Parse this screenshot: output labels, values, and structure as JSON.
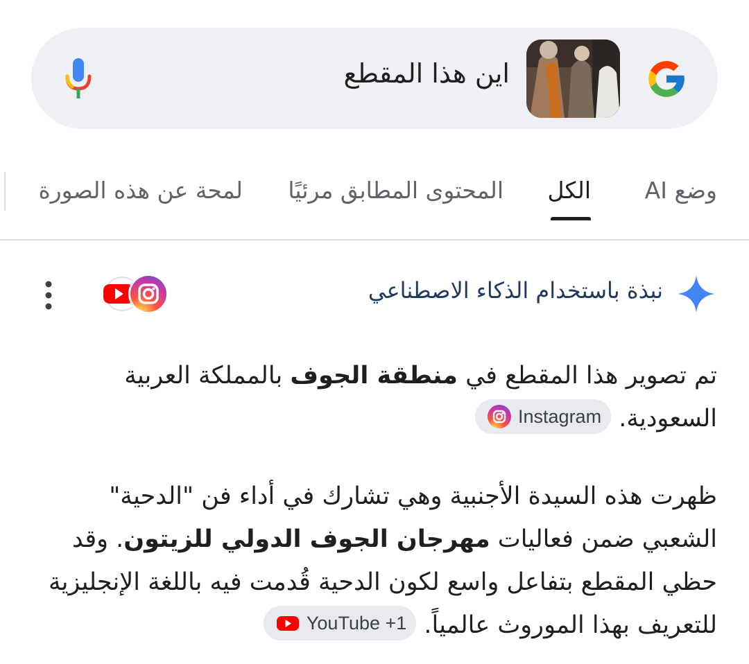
{
  "search": {
    "query": "اين هذا المقطع",
    "thumbnail": "image-thumbnail-people"
  },
  "tabs": [
    {
      "label": "وضع AI",
      "active": false
    },
    {
      "label": "الكل",
      "active": true
    },
    {
      "label": "المحتوى المطابق مرئيًا",
      "active": false
    },
    {
      "label": "لمحة عن هذه الصورة",
      "active": false
    }
  ],
  "ai_overview": {
    "title": "نبذة باستخدام الذكاء الاصطناعي",
    "icon": "sparkle-icon",
    "sources_icons": [
      "youtube-icon",
      "instagram-icon"
    ]
  },
  "paragraph1": {
    "t1": "تم تصوير هذا المقطع في ",
    "b1": "منطقة الجوف",
    "t2": " بالمملكة العربية السعودية. ",
    "chip": "Instagram"
  },
  "paragraph2": {
    "t1": "ظهرت هذه السيدة الأجنبية وهي تشارك في أداء فن \"الدحية\" الشعبي ضمن فعاليات ",
    "b1": "مهرجان الجوف الدولي للزيتون",
    "t2": ". وقد حظي المقطع بتفاعل واسع لكون الدحية قُدمت فيه باللغة الإنجليزية للتعريف بهذا الموروث عالمياً. ",
    "chip": "YouTube +1"
  },
  "colors": {
    "accent_blue": "#4285F4",
    "youtube_red": "#FF0000",
    "chip_bg": "#e8eaed",
    "searchbar_bg": "#eef0f3"
  }
}
